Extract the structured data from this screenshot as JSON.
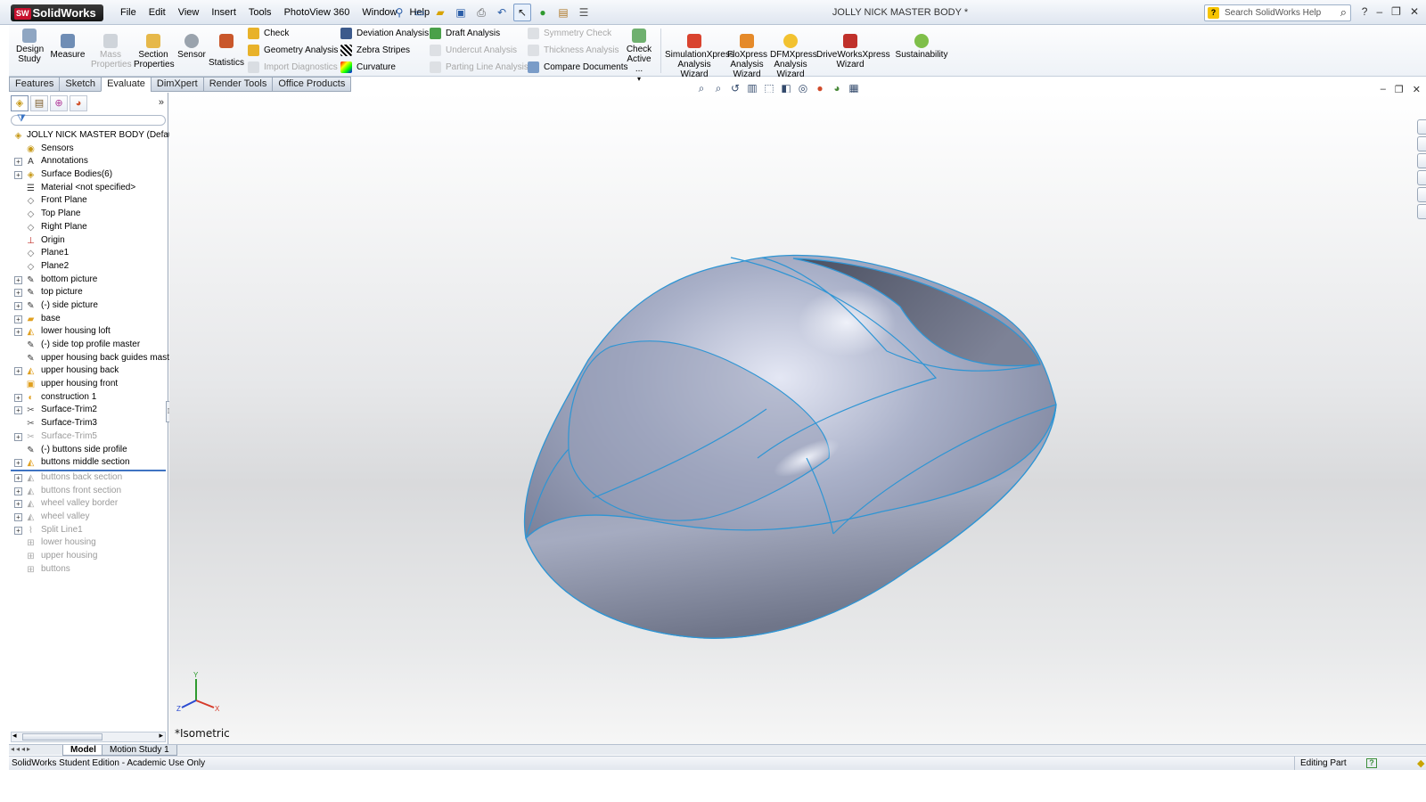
{
  "app": {
    "logo": "SolidWorks",
    "logo_badge": "SW",
    "document_title": "JOLLY NICK MASTER BODY *",
    "search_placeholder": "Search SolidWorks Help"
  },
  "menu": [
    "File",
    "Edit",
    "View",
    "Insert",
    "Tools",
    "PhotoView 360",
    "Window",
    "Help"
  ],
  "ribbon": {
    "design_study": "Design Study",
    "measure": "Measure",
    "mass_properties": "Mass Properties",
    "section_properties": "Section Properties",
    "sensor": "Sensor",
    "statistics": "Statistics",
    "check": "Check",
    "geometry_analysis": "Geometry Analysis",
    "import_diagnostics": "Import Diagnostics",
    "deviation_analysis": "Deviation Analysis",
    "zebra_stripes": "Zebra Stripes",
    "curvature": "Curvature",
    "draft_analysis": "Draft Analysis",
    "undercut_analysis": "Undercut Analysis",
    "parting_line_analysis": "Parting Line Analysis",
    "symmetry_check": "Symmetry Check",
    "thickness_analysis": "Thickness Analysis",
    "compare_documents": "Compare Documents",
    "check_active": "Check Active ...",
    "simulationxpress": "SimulationXpress Analysis Wizard",
    "floxpress": "FloXpress Analysis Wizard",
    "dfmxpress": "DFMXpress Analysis Wizard",
    "driveworksxpress": "DriveWorksXpress Wizard",
    "sustainability": "Sustainability"
  },
  "tabs": [
    "Features",
    "Sketch",
    "Evaluate",
    "DimXpert",
    "Render Tools",
    "Office Products"
  ],
  "active_tab": "Evaluate",
  "tree": {
    "root": "JOLLY NICK MASTER BODY  (Default<<",
    "items": [
      {
        "label": "Sensors",
        "icon": "sensor-icon",
        "expand": false
      },
      {
        "label": "Annotations",
        "icon": "annotations-icon",
        "expand": true
      },
      {
        "label": "Surface Bodies(6)",
        "icon": "surface-bodies-icon",
        "expand": true
      },
      {
        "label": "Material <not specified>",
        "icon": "material-icon",
        "expand": false
      },
      {
        "label": "Front Plane",
        "icon": "plane-icon",
        "expand": false
      },
      {
        "label": "Top Plane",
        "icon": "plane-icon",
        "expand": false
      },
      {
        "label": "Right Plane",
        "icon": "plane-icon",
        "expand": false
      },
      {
        "label": "Origin",
        "icon": "origin-icon",
        "expand": false
      },
      {
        "label": "Plane1",
        "icon": "plane-icon",
        "expand": false
      },
      {
        "label": "Plane2",
        "icon": "plane-icon",
        "expand": false
      },
      {
        "label": "bottom picture",
        "icon": "sketch-icon",
        "expand": true
      },
      {
        "label": "top picture",
        "icon": "sketch-icon",
        "expand": true
      },
      {
        "label": "(-) side picture",
        "icon": "sketch-icon",
        "expand": true
      },
      {
        "label": "base",
        "icon": "surface-feature-icon",
        "expand": true
      },
      {
        "label": "lower housing loft",
        "icon": "loft-icon",
        "expand": true
      },
      {
        "label": "(-) side top profile master",
        "icon": "sketch-icon",
        "expand": false
      },
      {
        "label": "upper housing back guides master",
        "icon": "sketch-icon",
        "expand": false
      },
      {
        "label": "upper housing back",
        "icon": "loft-icon",
        "expand": true
      },
      {
        "label": "upper housing front",
        "icon": "boundary-icon",
        "expand": false
      },
      {
        "label": "construction 1",
        "icon": "construction-icon",
        "expand": true
      },
      {
        "label": "Surface-Trim2",
        "icon": "trim-icon",
        "expand": true
      },
      {
        "label": "Surface-Trim3",
        "icon": "trim-icon",
        "expand": false
      },
      {
        "label": "Surface-Trim5",
        "icon": "trim-icon",
        "expand": true,
        "suppressed": true
      },
      {
        "label": "(-) buttons side profile",
        "icon": "sketch-icon",
        "expand": false
      },
      {
        "label": "buttons middle section",
        "icon": "loft-icon",
        "expand": true
      },
      {
        "label": "buttons back section",
        "icon": "loft-icon",
        "expand": true,
        "suppressed": true
      },
      {
        "label": "buttons front section",
        "icon": "loft-icon",
        "expand": true,
        "suppressed": true
      },
      {
        "label": "wheel valley border",
        "icon": "loft-icon",
        "expand": true,
        "suppressed": true
      },
      {
        "label": "wheel valley",
        "icon": "loft-icon",
        "expand": true,
        "suppressed": true
      },
      {
        "label": "Split Line1",
        "icon": "split-line-icon",
        "expand": true,
        "suppressed": true
      },
      {
        "label": "lower housing",
        "icon": "knit-icon",
        "expand": false,
        "suppressed": true
      },
      {
        "label": "upper housing",
        "icon": "knit-icon",
        "expand": false,
        "suppressed": true
      },
      {
        "label": "buttons",
        "icon": "knit-icon",
        "expand": false,
        "suppressed": true
      }
    ]
  },
  "viewport": {
    "view_name": "*Isometric",
    "triad_x": "X",
    "triad_y": "Y",
    "triad_z": "Z"
  },
  "bottom_tabs": [
    "Model",
    "Motion Study 1"
  ],
  "status": {
    "left": "SolidWorks Student Edition - Academic Use Only",
    "mode": "Editing Part"
  }
}
